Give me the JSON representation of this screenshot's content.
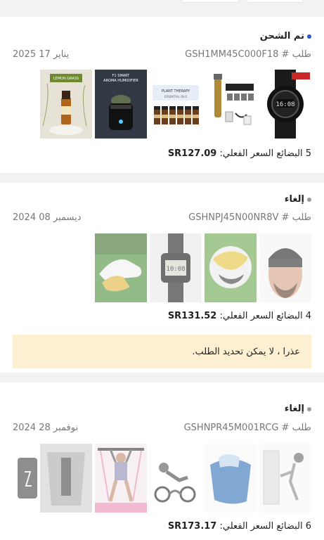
{
  "orders": [
    {
      "status": "تم الشحن",
      "status_color": "#2a57c9",
      "order_prefix": "طلب #",
      "order_id": "GSH1MM45C000F18",
      "date": "يناير 17 2025",
      "items_count": "5 البضائع السعر الفعلي:",
      "price": "SR127.09",
      "items": [
        "smartwatch-image",
        "hair-trimmer-image",
        "essential-oils-image",
        "humidifier-image",
        "lemongrass-oil-image"
      ]
    },
    {
      "status": "إلغاء",
      "status_color": "#999999",
      "order_prefix": "طلب #",
      "order_id": "GSHNPJ45N00NR8V",
      "date": "ديسمبر 08 2024",
      "items_count": "4 البضائع السعر الفعلي:",
      "price": "SR131.52",
      "notice": "عذرا ، لا يمكن تحديد الطلب.",
      "items": [
        "headband-image",
        "soccer-ball-image",
        "sport-watch-image",
        "football-boots-image"
      ]
    },
    {
      "status": "إلغاء",
      "status_color": "#999999",
      "order_prefix": "طلب #",
      "order_id": "GSHNPR45M001RCG",
      "date": "نوفمبر 28 2024",
      "items_count": "6 البضائع السعر الفعلي:",
      "price": "SR173.17",
      "items": [
        "door-anchor-image",
        "cooling-towel-image",
        "resistance-bands-image",
        "pilates-bar-image",
        "exercise-equipment-image",
        "phone-case-image"
      ]
    }
  ]
}
